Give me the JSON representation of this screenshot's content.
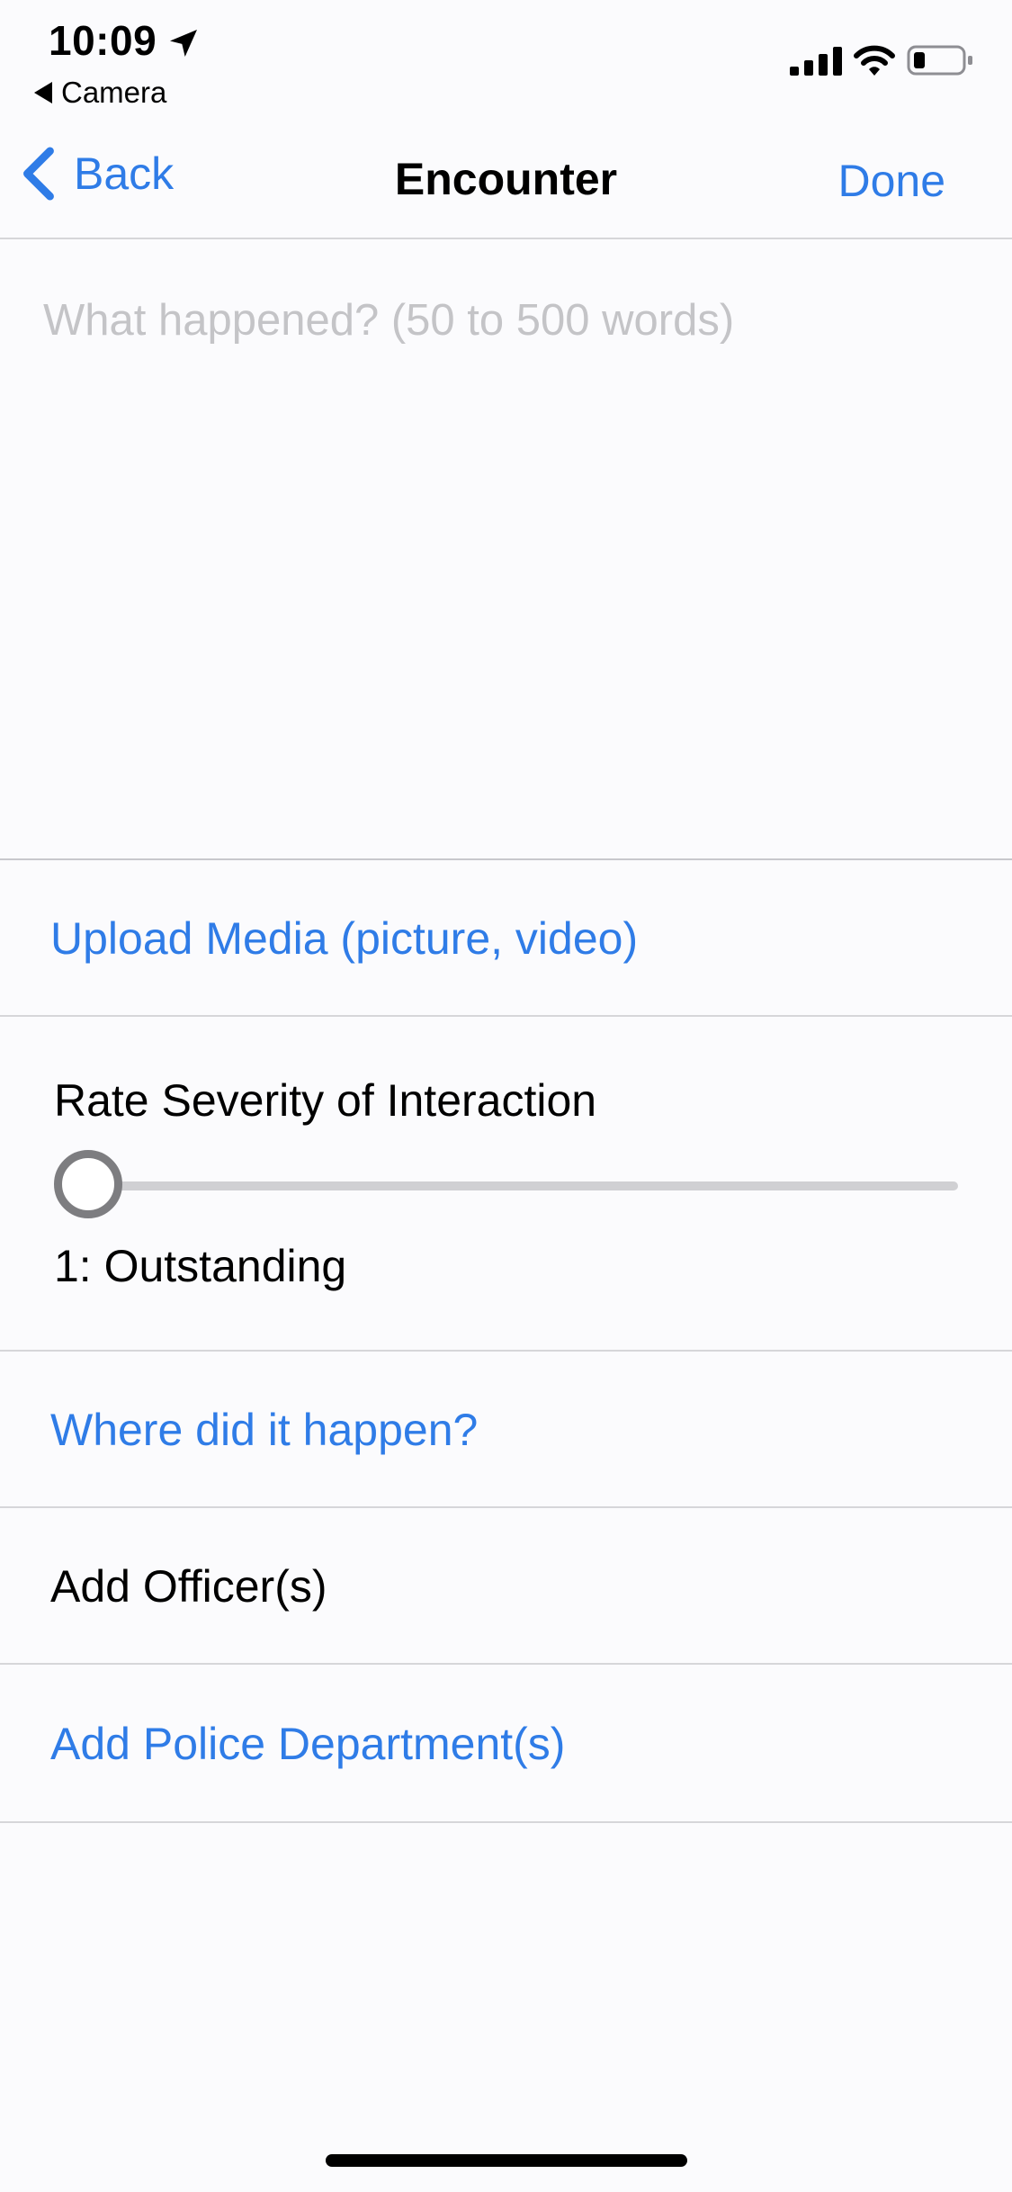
{
  "status_bar": {
    "time": "10:09",
    "back_app": "Camera",
    "icons": [
      "location-arrow-icon",
      "signal-icon",
      "wifi-icon",
      "battery-icon"
    ]
  },
  "nav": {
    "back_label": "Back",
    "title": "Encounter",
    "done_label": "Done"
  },
  "form": {
    "description_placeholder": "What happened? (50 to 500 words)",
    "description_value": "",
    "upload_media_label": "Upload Media (picture, video)",
    "severity": {
      "label": "Rate Severity of Interaction",
      "value": 1,
      "value_text": "1: Outstanding"
    },
    "location_label": "Where did it happen?",
    "add_officers_label": "Add Officer(s)",
    "add_departments_label": "Add Police Department(s)"
  },
  "colors": {
    "accent": "#2f7ce7",
    "background": "#fbfbfd",
    "separator": "#d6d6d9",
    "placeholder": "#c4c4c7"
  }
}
